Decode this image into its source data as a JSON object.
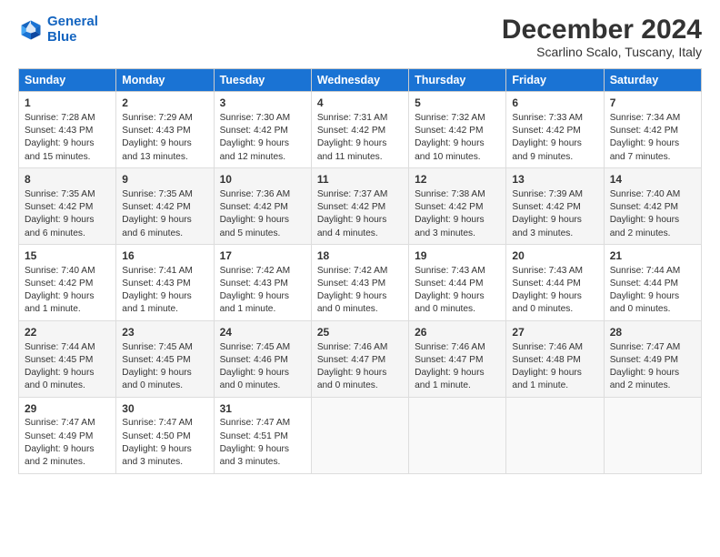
{
  "logo": {
    "line1": "General",
    "line2": "Blue"
  },
  "title": "December 2024",
  "location": "Scarlino Scalo, Tuscany, Italy",
  "days_of_week": [
    "Sunday",
    "Monday",
    "Tuesday",
    "Wednesday",
    "Thursday",
    "Friday",
    "Saturday"
  ],
  "weeks": [
    [
      {
        "day": "1",
        "lines": [
          "Sunrise: 7:28 AM",
          "Sunset: 4:43 PM",
          "Daylight: 9 hours",
          "and 15 minutes."
        ]
      },
      {
        "day": "2",
        "lines": [
          "Sunrise: 7:29 AM",
          "Sunset: 4:43 PM",
          "Daylight: 9 hours",
          "and 13 minutes."
        ]
      },
      {
        "day": "3",
        "lines": [
          "Sunrise: 7:30 AM",
          "Sunset: 4:42 PM",
          "Daylight: 9 hours",
          "and 12 minutes."
        ]
      },
      {
        "day": "4",
        "lines": [
          "Sunrise: 7:31 AM",
          "Sunset: 4:42 PM",
          "Daylight: 9 hours",
          "and 11 minutes."
        ]
      },
      {
        "day": "5",
        "lines": [
          "Sunrise: 7:32 AM",
          "Sunset: 4:42 PM",
          "Daylight: 9 hours",
          "and 10 minutes."
        ]
      },
      {
        "day": "6",
        "lines": [
          "Sunrise: 7:33 AM",
          "Sunset: 4:42 PM",
          "Daylight: 9 hours",
          "and 9 minutes."
        ]
      },
      {
        "day": "7",
        "lines": [
          "Sunrise: 7:34 AM",
          "Sunset: 4:42 PM",
          "Daylight: 9 hours",
          "and 7 minutes."
        ]
      }
    ],
    [
      {
        "day": "8",
        "lines": [
          "Sunrise: 7:35 AM",
          "Sunset: 4:42 PM",
          "Daylight: 9 hours",
          "and 6 minutes."
        ]
      },
      {
        "day": "9",
        "lines": [
          "Sunrise: 7:35 AM",
          "Sunset: 4:42 PM",
          "Daylight: 9 hours",
          "and 6 minutes."
        ]
      },
      {
        "day": "10",
        "lines": [
          "Sunrise: 7:36 AM",
          "Sunset: 4:42 PM",
          "Daylight: 9 hours",
          "and 5 minutes."
        ]
      },
      {
        "day": "11",
        "lines": [
          "Sunrise: 7:37 AM",
          "Sunset: 4:42 PM",
          "Daylight: 9 hours",
          "and 4 minutes."
        ]
      },
      {
        "day": "12",
        "lines": [
          "Sunrise: 7:38 AM",
          "Sunset: 4:42 PM",
          "Daylight: 9 hours",
          "and 3 minutes."
        ]
      },
      {
        "day": "13",
        "lines": [
          "Sunrise: 7:39 AM",
          "Sunset: 4:42 PM",
          "Daylight: 9 hours",
          "and 3 minutes."
        ]
      },
      {
        "day": "14",
        "lines": [
          "Sunrise: 7:40 AM",
          "Sunset: 4:42 PM",
          "Daylight: 9 hours",
          "and 2 minutes."
        ]
      }
    ],
    [
      {
        "day": "15",
        "lines": [
          "Sunrise: 7:40 AM",
          "Sunset: 4:42 PM",
          "Daylight: 9 hours",
          "and 1 minute."
        ]
      },
      {
        "day": "16",
        "lines": [
          "Sunrise: 7:41 AM",
          "Sunset: 4:43 PM",
          "Daylight: 9 hours",
          "and 1 minute."
        ]
      },
      {
        "day": "17",
        "lines": [
          "Sunrise: 7:42 AM",
          "Sunset: 4:43 PM",
          "Daylight: 9 hours",
          "and 1 minute."
        ]
      },
      {
        "day": "18",
        "lines": [
          "Sunrise: 7:42 AM",
          "Sunset: 4:43 PM",
          "Daylight: 9 hours",
          "and 0 minutes."
        ]
      },
      {
        "day": "19",
        "lines": [
          "Sunrise: 7:43 AM",
          "Sunset: 4:44 PM",
          "Daylight: 9 hours",
          "and 0 minutes."
        ]
      },
      {
        "day": "20",
        "lines": [
          "Sunrise: 7:43 AM",
          "Sunset: 4:44 PM",
          "Daylight: 9 hours",
          "and 0 minutes."
        ]
      },
      {
        "day": "21",
        "lines": [
          "Sunrise: 7:44 AM",
          "Sunset: 4:44 PM",
          "Daylight: 9 hours",
          "and 0 minutes."
        ]
      }
    ],
    [
      {
        "day": "22",
        "lines": [
          "Sunrise: 7:44 AM",
          "Sunset: 4:45 PM",
          "Daylight: 9 hours",
          "and 0 minutes."
        ]
      },
      {
        "day": "23",
        "lines": [
          "Sunrise: 7:45 AM",
          "Sunset: 4:45 PM",
          "Daylight: 9 hours",
          "and 0 minutes."
        ]
      },
      {
        "day": "24",
        "lines": [
          "Sunrise: 7:45 AM",
          "Sunset: 4:46 PM",
          "Daylight: 9 hours",
          "and 0 minutes."
        ]
      },
      {
        "day": "25",
        "lines": [
          "Sunrise: 7:46 AM",
          "Sunset: 4:47 PM",
          "Daylight: 9 hours",
          "and 0 minutes."
        ]
      },
      {
        "day": "26",
        "lines": [
          "Sunrise: 7:46 AM",
          "Sunset: 4:47 PM",
          "Daylight: 9 hours",
          "and 1 minute."
        ]
      },
      {
        "day": "27",
        "lines": [
          "Sunrise: 7:46 AM",
          "Sunset: 4:48 PM",
          "Daylight: 9 hours",
          "and 1 minute."
        ]
      },
      {
        "day": "28",
        "lines": [
          "Sunrise: 7:47 AM",
          "Sunset: 4:49 PM",
          "Daylight: 9 hours",
          "and 2 minutes."
        ]
      }
    ],
    [
      {
        "day": "29",
        "lines": [
          "Sunrise: 7:47 AM",
          "Sunset: 4:49 PM",
          "Daylight: 9 hours",
          "and 2 minutes."
        ]
      },
      {
        "day": "30",
        "lines": [
          "Sunrise: 7:47 AM",
          "Sunset: 4:50 PM",
          "Daylight: 9 hours",
          "and 3 minutes."
        ]
      },
      {
        "day": "31",
        "lines": [
          "Sunrise: 7:47 AM",
          "Sunset: 4:51 PM",
          "Daylight: 9 hours",
          "and 3 minutes."
        ]
      },
      null,
      null,
      null,
      null
    ]
  ]
}
